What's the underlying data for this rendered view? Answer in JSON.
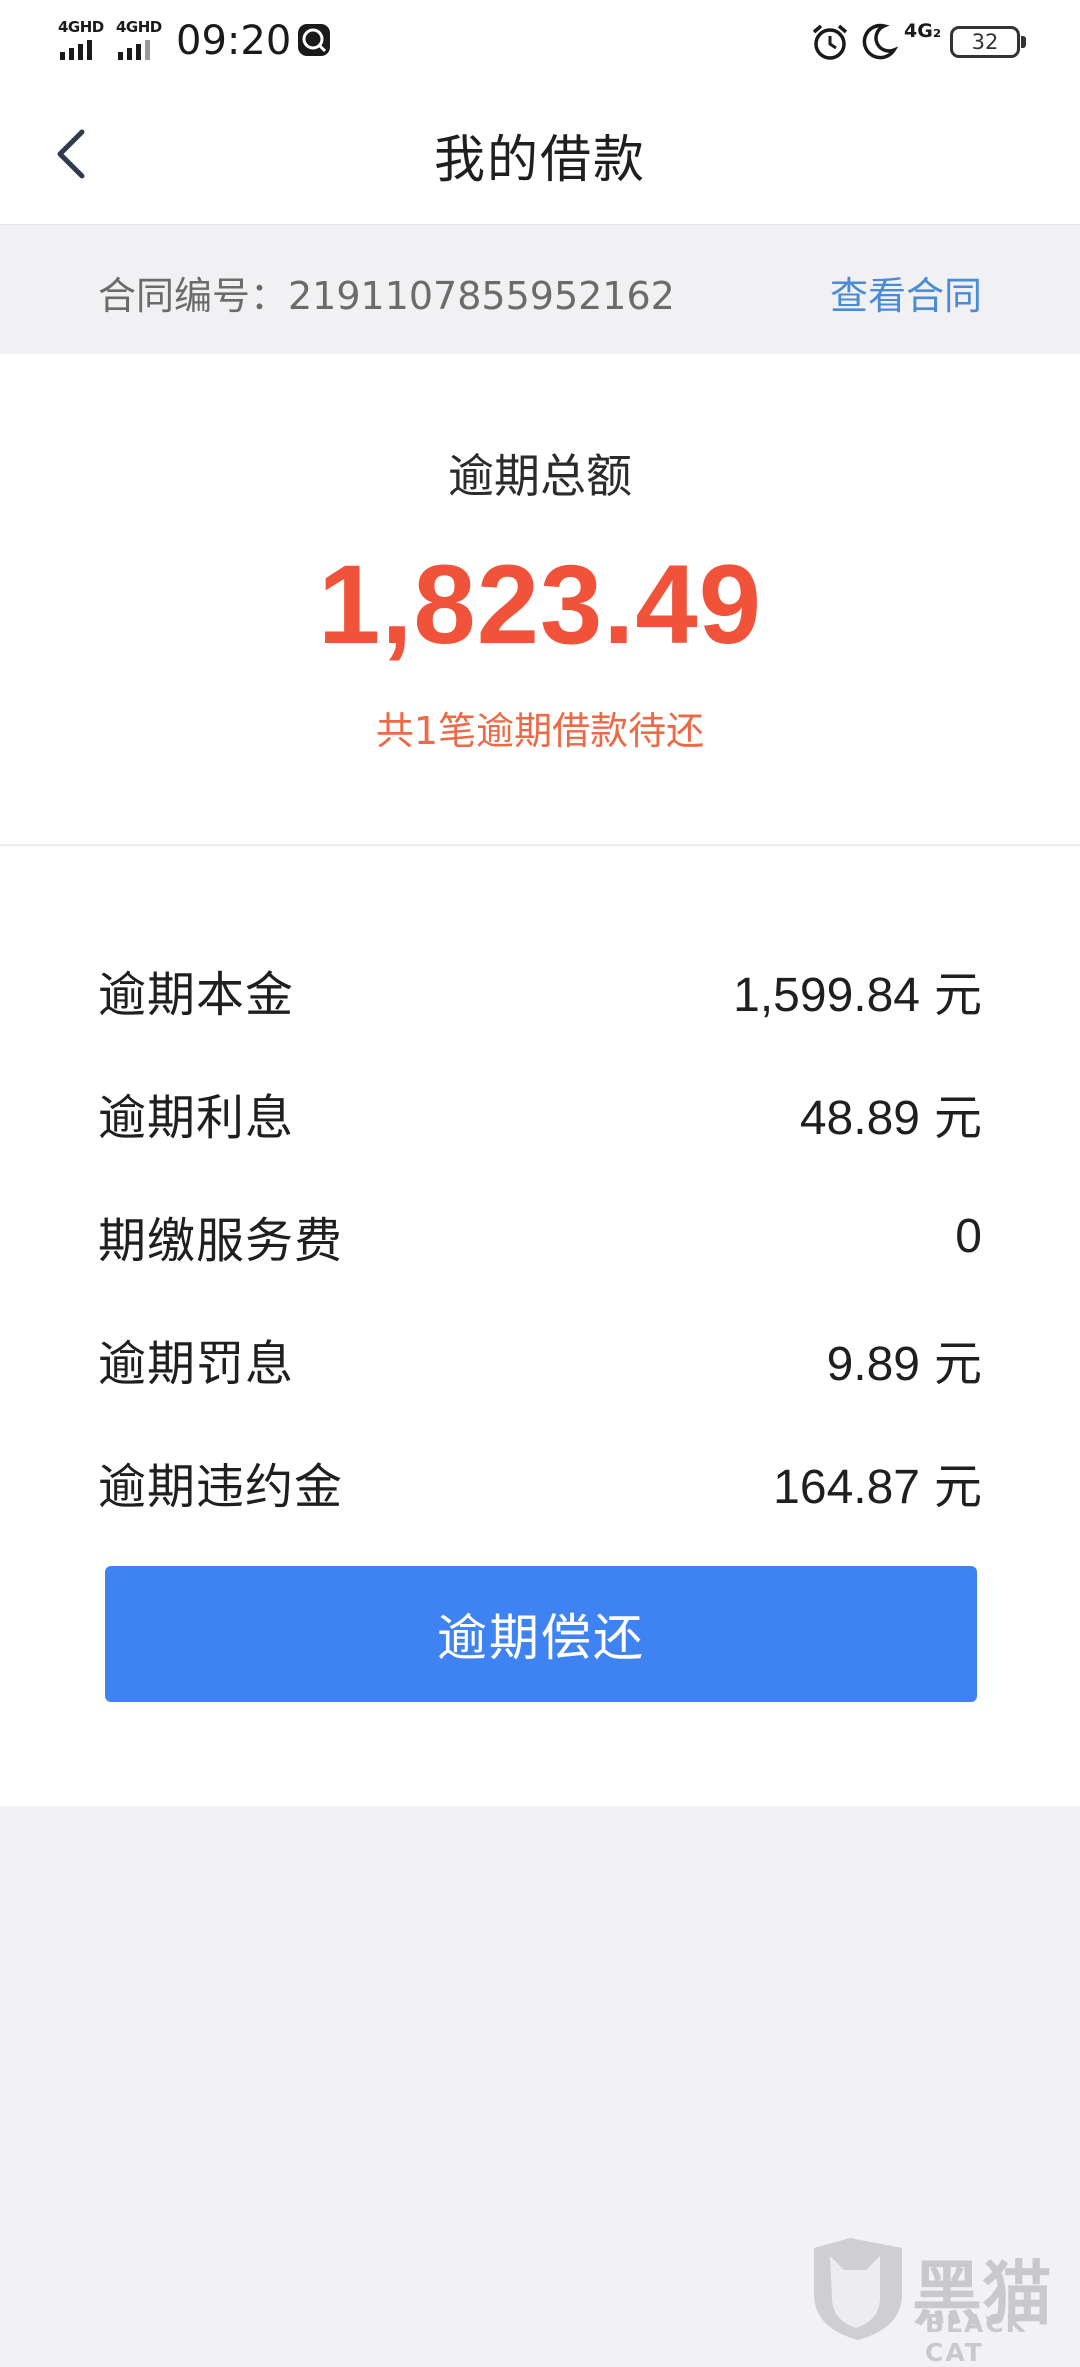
{
  "status_bar": {
    "network1": "4GHD",
    "network2": "4GHD",
    "time": "09:20",
    "network3": "4G₂",
    "battery": "32"
  },
  "nav": {
    "title": "我的借款"
  },
  "contract": {
    "label": "合同编号：2191107855952162",
    "link": "查看合同"
  },
  "summary": {
    "label": "逾期总额",
    "amount": "1,823.49",
    "subtitle": "共1笔逾期借款待还",
    "amount_color": "#f0533a"
  },
  "details": [
    {
      "label": "逾期本金",
      "value": "1,599.84",
      "unit": "元"
    },
    {
      "label": "逾期利息",
      "value": "48.89",
      "unit": "元"
    },
    {
      "label": "期缴服务费",
      "value": "0",
      "unit": ""
    },
    {
      "label": "逾期罚息",
      "value": "9.89",
      "unit": "元"
    },
    {
      "label": "逾期违约金",
      "value": "164.87",
      "unit": "元"
    }
  ],
  "repay_button": {
    "label": "逾期偿还",
    "color": "#3f82f1"
  },
  "watermark": {
    "text_cn": "黑猫",
    "text_en": "BLACK CAT"
  }
}
